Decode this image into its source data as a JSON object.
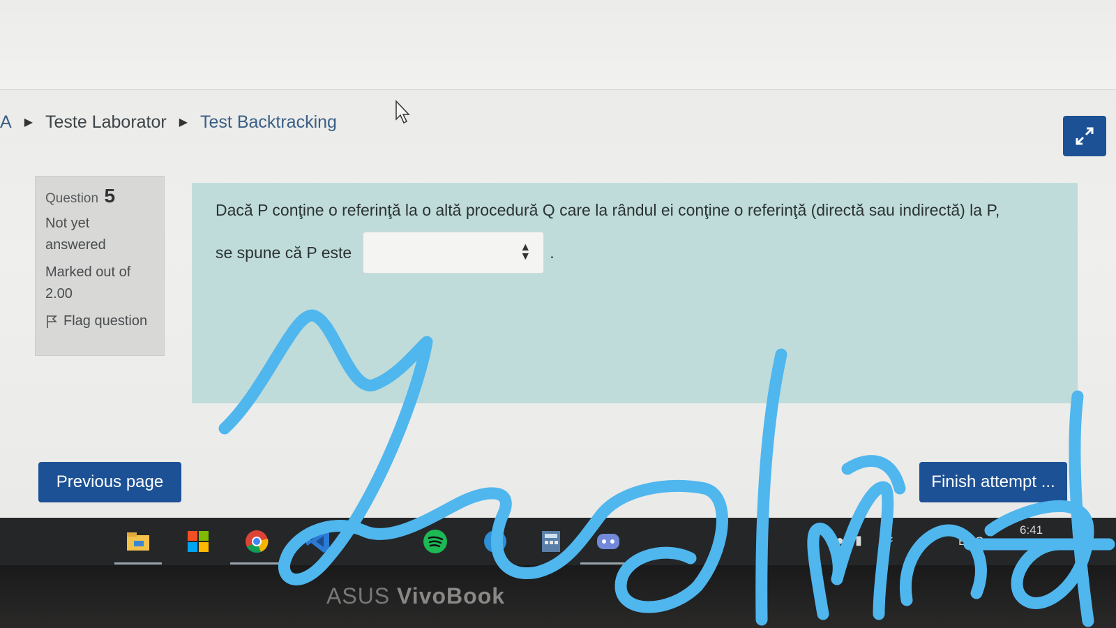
{
  "breadcrumb": {
    "edge_fragment": "A",
    "items": [
      "Teste Laborator",
      "Test Backtracking"
    ]
  },
  "question_info": {
    "label": "Question",
    "number": "5",
    "status_line1": "Not yet",
    "status_line2": "answered",
    "marked_line1": "Marked out of",
    "marked_line2": "2.00",
    "flag_label": "Flag question"
  },
  "question": {
    "text_line1": "Dacă P conţine o referinţă la o altă procedură Q care la rândul ei conţine o referinţă (directă sau indirectă) la P,",
    "text_line2": "se spune că P este",
    "select_value": "",
    "period": "."
  },
  "navigation": {
    "previous_label": "Previous page",
    "finish_label": "Finish attempt ..."
  },
  "taskbar": {
    "apps": [
      "file-explorer-icon",
      "windows-store-icon",
      "chrome-icon",
      "vscode-icon",
      "spotify-icon",
      "edge-icon",
      "calculator-icon",
      "discord-icon"
    ],
    "language": "ENG",
    "time": "6:41"
  },
  "laptop": {
    "brand_prefix": "ASUS ",
    "brand_model": "VivoBook"
  },
  "colors": {
    "primary_button": "#1d5195",
    "question_bg": "#bfdcda",
    "scribble": "#4fb6ee"
  }
}
